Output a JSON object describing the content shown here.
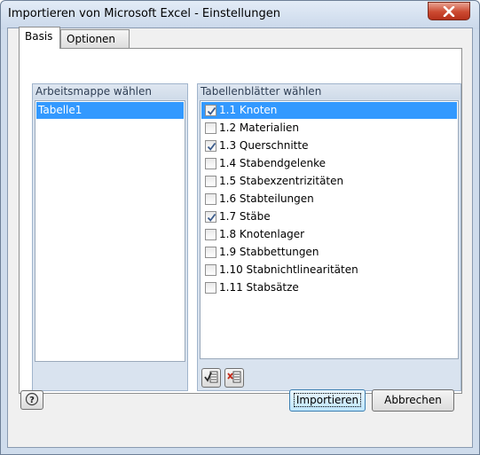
{
  "window": {
    "title": "Importieren von Microsoft Excel - Einstellungen"
  },
  "tabs": [
    {
      "label": "Basis",
      "active": true
    },
    {
      "label": "Optionen",
      "active": false
    }
  ],
  "workbook_group": {
    "header": "Arbeitsmappe wählen",
    "items": [
      {
        "label": "Tabelle1",
        "selected": true
      }
    ]
  },
  "sheets_group": {
    "header": "Tabellenblätter wählen",
    "items": [
      {
        "label": "1.1 Knoten",
        "checked": true,
        "selected": true
      },
      {
        "label": "1.2 Materialien",
        "checked": false,
        "selected": false
      },
      {
        "label": "1.3 Querschnitte",
        "checked": true,
        "selected": false
      },
      {
        "label": "1.4 Stabendgelenke",
        "checked": false,
        "selected": false
      },
      {
        "label": "1.5 Stabexzentrizitäten",
        "checked": false,
        "selected": false
      },
      {
        "label": "1.6 Stabteilungen",
        "checked": false,
        "selected": false
      },
      {
        "label": "1.7 Stäbe",
        "checked": true,
        "selected": false
      },
      {
        "label": "1.8 Knotenlager",
        "checked": false,
        "selected": false
      },
      {
        "label": "1.9 Stabbettungen",
        "checked": false,
        "selected": false
      },
      {
        "label": "1.10 Stabnichtlinearitäten",
        "checked": false,
        "selected": false
      },
      {
        "label": "1.11 Stabsätze",
        "checked": false,
        "selected": false
      }
    ],
    "toolbar": [
      {
        "icon": "select-all-icon"
      },
      {
        "icon": "deselect-all-icon"
      }
    ]
  },
  "footer": {
    "help_icon": "help-icon",
    "import_label": "Importieren",
    "cancel_label": "Abbrechen"
  },
  "colors": {
    "selection": "#3399ff",
    "group_header": "#d9e3ef",
    "close_button": "#c8422b"
  }
}
